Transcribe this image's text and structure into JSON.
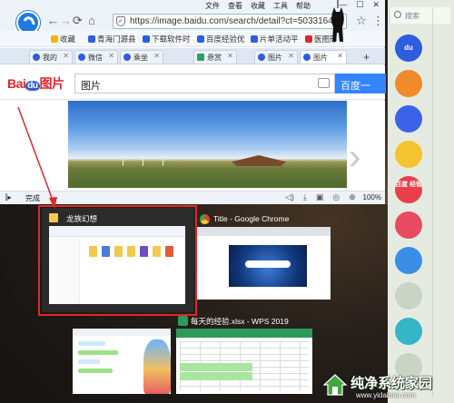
{
  "menu": {
    "items": [
      "文件",
      "查看",
      "收藏",
      "工具",
      "帮助"
    ]
  },
  "window_controls": {
    "restore": "□",
    "minimize": "—",
    "maximize": "☐",
    "close": "✕"
  },
  "nav": {
    "back": "←",
    "forward": "→",
    "refresh": "⟳",
    "home": "⌂",
    "url": "https://image.baidu.com/search/detail?ct=50331648",
    "security": "✓",
    "star": "☆",
    "more": "⋮"
  },
  "bookmarks": {
    "favorites": "收藏",
    "items": [
      "青海门源县",
      "下载软件时",
      "百度经验优",
      "片单活动平",
      "医图形"
    ]
  },
  "tabs": [
    "我的",
    "微信",
    "乘坐",
    "悬赏",
    "图片",
    "图片"
  ],
  "tab_plus": "+",
  "baidu": {
    "logo_bai": "Bai",
    "logo_du": "du",
    "logo_img": "图片",
    "query": "图片",
    "search_button": "百度一"
  },
  "status": {
    "done": "完成",
    "zoom": "100%"
  },
  "sidebar": {
    "search_placeholder": "搜索",
    "icons": [
      "du",
      "",
      "",
      "",
      "百度\n经验",
      "",
      "",
      "",
      "",
      ""
    ]
  },
  "switcher": {
    "explorer_title": "龙族幻想",
    "chrome_title": "Title - Google Chrome",
    "wps_title": "每天的经验.xlsx - WPS 2019"
  },
  "watermark": {
    "title": "纯净系统家园",
    "url": "www.yidaimei.com"
  },
  "colors": {
    "highlight": "#e4262a",
    "baidu_blue": "#3385ff",
    "baidu_red": "#e0262c"
  }
}
